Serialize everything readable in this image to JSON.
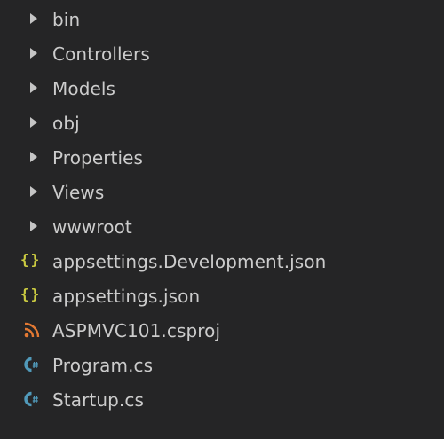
{
  "explorer": {
    "items": [
      {
        "label": "bin",
        "kind": "folder",
        "icon": "chevron-right-icon"
      },
      {
        "label": "Controllers",
        "kind": "folder",
        "icon": "chevron-right-icon"
      },
      {
        "label": "Models",
        "kind": "folder",
        "icon": "chevron-right-icon"
      },
      {
        "label": "obj",
        "kind": "folder",
        "icon": "chevron-right-icon"
      },
      {
        "label": "Properties",
        "kind": "folder",
        "icon": "chevron-right-icon"
      },
      {
        "label": "Views",
        "kind": "folder",
        "icon": "chevron-right-icon"
      },
      {
        "label": "wwwroot",
        "kind": "folder",
        "icon": "chevron-right-icon"
      },
      {
        "label": "appsettings.Development.json",
        "kind": "json",
        "icon": "json-icon"
      },
      {
        "label": "appsettings.json",
        "kind": "json",
        "icon": "json-icon"
      },
      {
        "label": "ASPMVC101.csproj",
        "kind": "csproj",
        "icon": "rss-icon"
      },
      {
        "label": "Program.cs",
        "kind": "csharp",
        "icon": "csharp-icon"
      },
      {
        "label": "Startup.cs",
        "kind": "csharp",
        "icon": "csharp-icon"
      }
    ]
  },
  "colors": {
    "background": "#252526",
    "text": "#cccccc",
    "chevron": "#c5c5c5",
    "json": "#cbcb41",
    "csproj": "#e37933",
    "csharp": "#519aba"
  }
}
